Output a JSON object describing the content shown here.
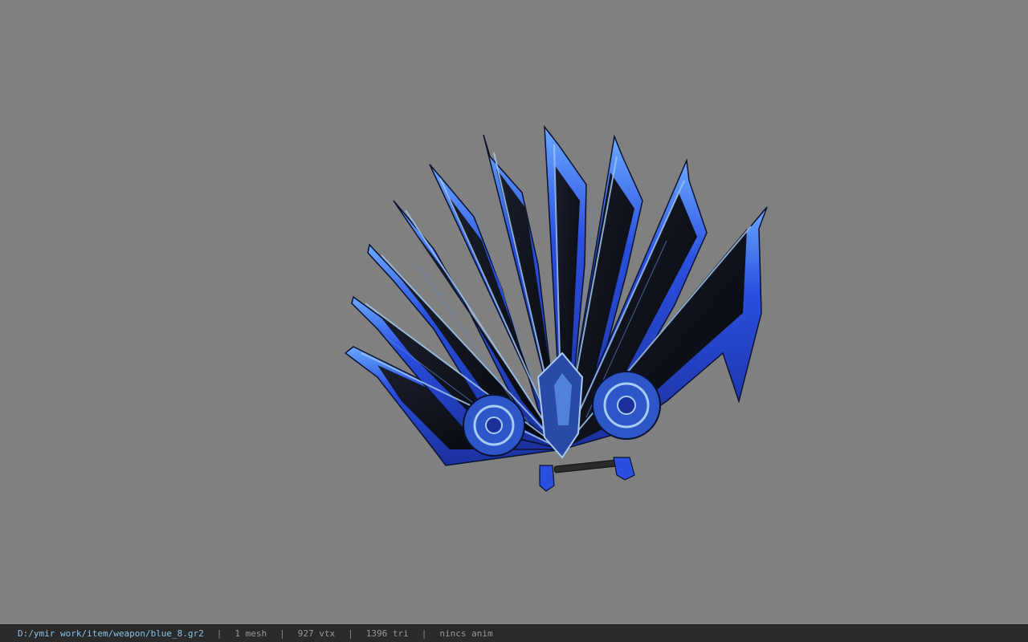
{
  "viewer": {
    "background_color": "#808080",
    "model_name": "blue_8",
    "model_colors": {
      "primary_blue": "#2a4fe0",
      "edge_blue": "#6aa8ff",
      "dark_panel": "#0b0d14",
      "trim": "#9ec4ee"
    }
  },
  "status": {
    "path": "D:/ymir work/item/weapon/blue_8.gr2",
    "separator": "|",
    "mesh": "1 mesh",
    "vertices": "927 vtx",
    "triangles": "1396 tri",
    "anim": "nincs anim"
  }
}
